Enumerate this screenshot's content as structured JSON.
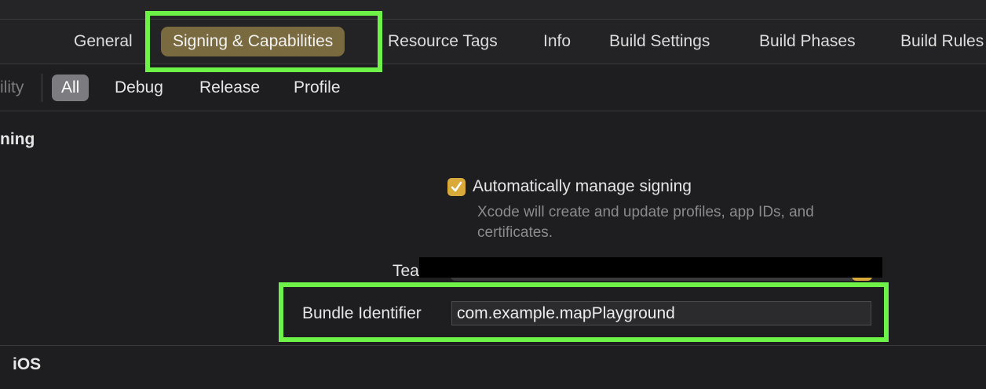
{
  "tabs": {
    "items": [
      "General",
      "Signing & Capabilities",
      "Resource Tags",
      "Info",
      "Build Settings",
      "Build Phases",
      "Build Rules"
    ],
    "active": "Signing & Capabilities"
  },
  "filters": {
    "truncated_left": "ility",
    "items": [
      "All",
      "Debug",
      "Release",
      "Profile"
    ],
    "selected": "All"
  },
  "signing": {
    "section_title": "ning",
    "auto_manage_label": "Automatically manage signing",
    "auto_manage_checked": true,
    "auto_manage_description": "Xcode will create and update profiles, app IDs, and certificates.",
    "team_label": "Team",
    "team_label_visible": "Tea",
    "bundle_identifier_label": "Bundle Identifier",
    "bundle_identifier_value": "com.example.mapPlayground"
  },
  "platform_section": {
    "label": "iOS"
  },
  "colors": {
    "accent_highlight": "#6ff247",
    "active_tab_pill": "#7a6a3f",
    "checkbox": "#d9a93a",
    "filter_pill": "#7b7b80",
    "background": "#1e1e20"
  }
}
